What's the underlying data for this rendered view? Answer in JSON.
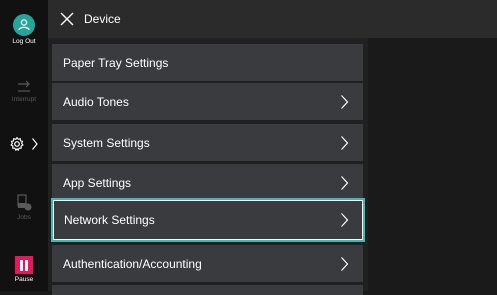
{
  "sidebar": {
    "logout_label": "Log Out",
    "interrupt_label": "Interrupt",
    "jobs_label": "Jobs",
    "pause_label": "Pause"
  },
  "header": {
    "title": "Device"
  },
  "menu": {
    "items": [
      {
        "label": "Paper Tray Settings",
        "has_chevron": false
      },
      {
        "label": "Audio Tones",
        "has_chevron": true
      },
      {
        "label": "System Settings",
        "has_chevron": true
      },
      {
        "label": "App Settings",
        "has_chevron": true
      },
      {
        "label": "Network Settings",
        "has_chevron": true,
        "selected": true
      },
      {
        "label": "Authentication/Accounting",
        "has_chevron": true
      }
    ]
  },
  "colors": {
    "accent": "#3fb9b1",
    "logout": "#26a69a",
    "pause": "#e8175d",
    "row_bg": "#3a3b3f"
  }
}
